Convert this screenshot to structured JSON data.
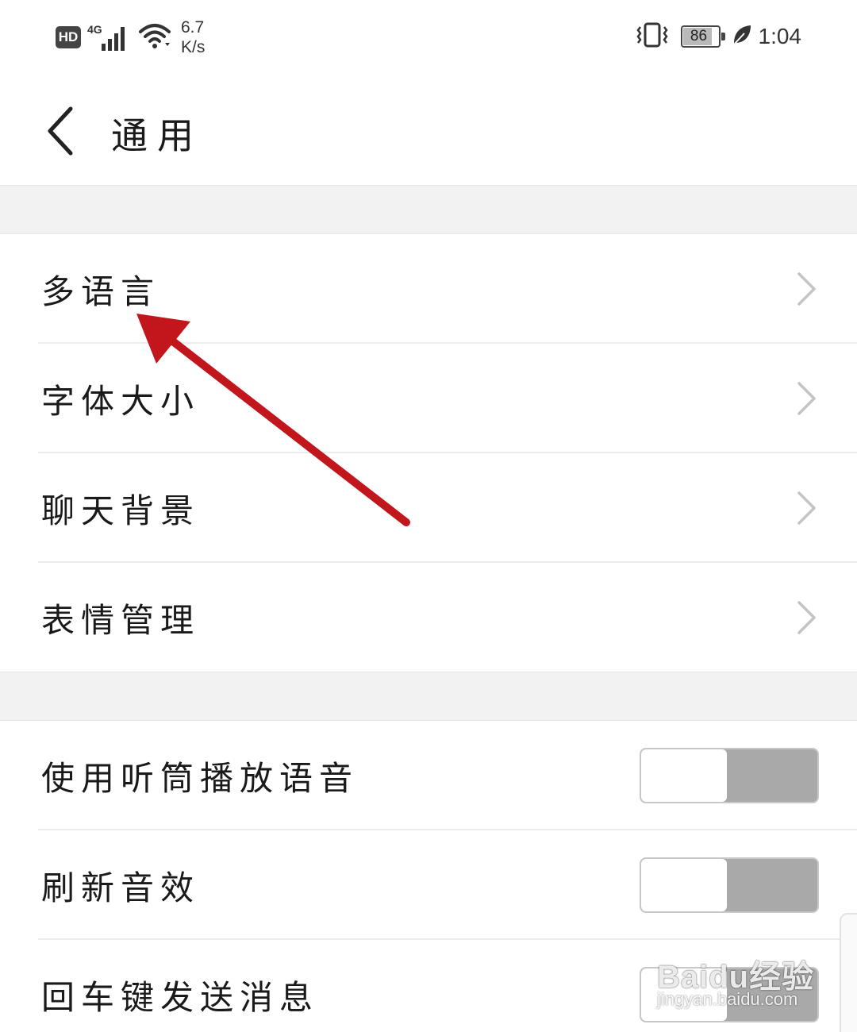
{
  "status_bar": {
    "hd": "HD",
    "network": "4G",
    "speed_value": "6.7",
    "speed_unit": "K/s",
    "battery": "86",
    "time": "1:04",
    "icons": [
      "hd-icon",
      "signal-icon",
      "wifi-icon",
      "vibrate-icon",
      "battery-icon",
      "leaf-icon"
    ]
  },
  "header": {
    "title": "通用",
    "back_icon": "chevron-left-icon"
  },
  "section1": {
    "items": [
      {
        "label": "多语言",
        "control": "chevron"
      },
      {
        "label": "字体大小",
        "control": "chevron"
      },
      {
        "label": "聊天背景",
        "control": "chevron"
      },
      {
        "label": "表情管理",
        "control": "chevron"
      }
    ]
  },
  "section2": {
    "items": [
      {
        "label": "使用听筒播放语音",
        "control": "toggle",
        "on": false
      },
      {
        "label": "刷新音效",
        "control": "toggle",
        "on": false
      },
      {
        "label": "回车键发送消息",
        "control": "toggle",
        "on": false
      }
    ]
  },
  "annotation": {
    "type": "arrow",
    "color": "#c0161c",
    "points_to": "多语言"
  },
  "watermark": {
    "logo": "Baidu经验",
    "url": "jingyan.baidu.com"
  },
  "colors": {
    "toggle_off_track": "#a9a9a9",
    "section_gap": "#f2f2f2",
    "chevron": "#c4c4c4"
  }
}
